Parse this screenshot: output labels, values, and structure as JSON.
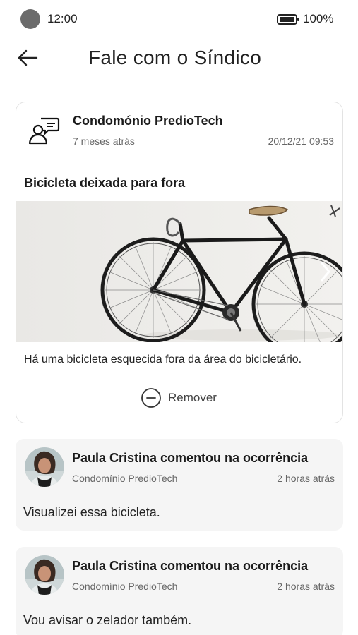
{
  "status_bar": {
    "time": "12:00",
    "battery": "100%"
  },
  "header": {
    "title": "Fale com o Síndico"
  },
  "post": {
    "author": "Condomónio PredioTech",
    "ago": "7 meses atrás",
    "datetime": "20/12/21 09:53",
    "title": "Bicicleta deixada para fora",
    "body": "Há uma bicicleta esquecida fora da área do bicicletário.",
    "remove_label": "Remover"
  },
  "comments": [
    {
      "title": "Paula Cristina comentou na ocorrência",
      "condo": "Condomínio PredioTech",
      "ago": "2 horas atrás",
      "text": "Visualizei essa bicicleta."
    },
    {
      "title": "Paula Cristina comentou na ocorrência",
      "condo": "Condomínio PredioTech",
      "ago": "2 horas atrás",
      "text": "Vou avisar o zelador também."
    }
  ],
  "icons": {
    "back": "arrow-left-icon",
    "chat": "chat-bubble-person-icon",
    "next": "chevron-right-icon",
    "remove": "minus-circle-icon",
    "battery": "battery-full-icon"
  },
  "colors": {
    "comment_background": "#f5f5f5",
    "border": "#e3e3e3"
  }
}
